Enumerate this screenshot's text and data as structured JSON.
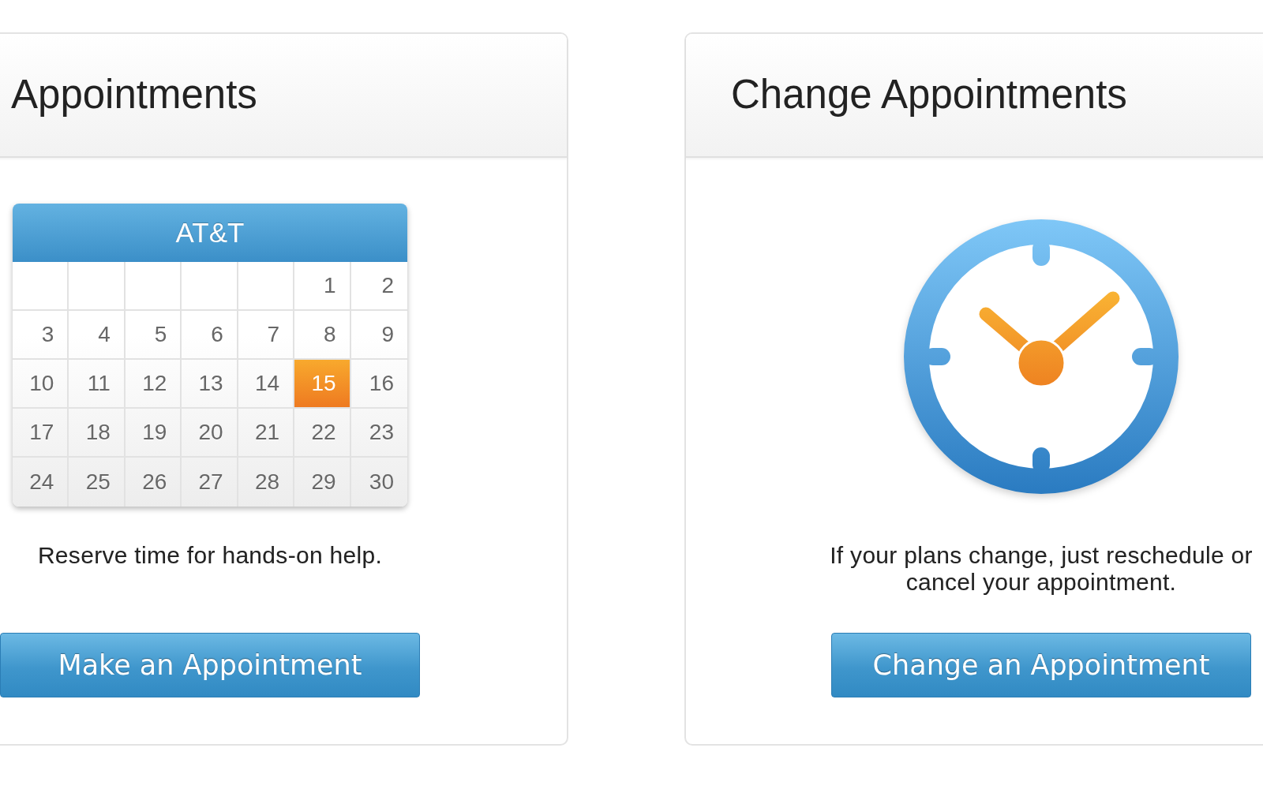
{
  "cards": [
    {
      "kind": "calendar",
      "title": "Appointments",
      "calendar": {
        "title": "AT&T",
        "days": [
          {
            "label": "1",
            "selected": false
          },
          {
            "label": "2",
            "selected": false
          },
          {
            "label": "3",
            "selected": false
          },
          {
            "label": "4",
            "selected": false
          },
          {
            "label": "5",
            "selected": false
          },
          {
            "label": "6",
            "selected": false
          },
          {
            "label": "7",
            "selected": false
          },
          {
            "label": "8",
            "selected": false
          },
          {
            "label": "9",
            "selected": false
          },
          {
            "label": "10",
            "selected": false
          },
          {
            "label": "11",
            "selected": false
          },
          {
            "label": "12",
            "selected": false
          },
          {
            "label": "13",
            "selected": false
          },
          {
            "label": "14",
            "selected": false
          },
          {
            "label": "15",
            "selected": true
          },
          {
            "label": "16",
            "selected": false
          },
          {
            "label": "17",
            "selected": false
          },
          {
            "label": "18",
            "selected": false
          },
          {
            "label": "19",
            "selected": false
          },
          {
            "label": "20",
            "selected": false
          },
          {
            "label": "21",
            "selected": false
          },
          {
            "label": "22",
            "selected": false
          },
          {
            "label": "23",
            "selected": false
          },
          {
            "label": "24",
            "selected": false
          },
          {
            "label": "25",
            "selected": false
          },
          {
            "label": "26",
            "selected": false
          },
          {
            "label": "27",
            "selected": false
          },
          {
            "label": "28",
            "selected": false
          },
          {
            "label": "29",
            "selected": false
          },
          {
            "label": "30",
            "selected": false
          }
        ]
      },
      "description": "Reserve time for hands-on help.",
      "button": "Make an Appointment"
    },
    {
      "kind": "clock",
      "title": "Change Appointments",
      "description": "If your plans change, just reschedule or cancel your appointment.",
      "button": "Change an Appointment"
    }
  ]
}
